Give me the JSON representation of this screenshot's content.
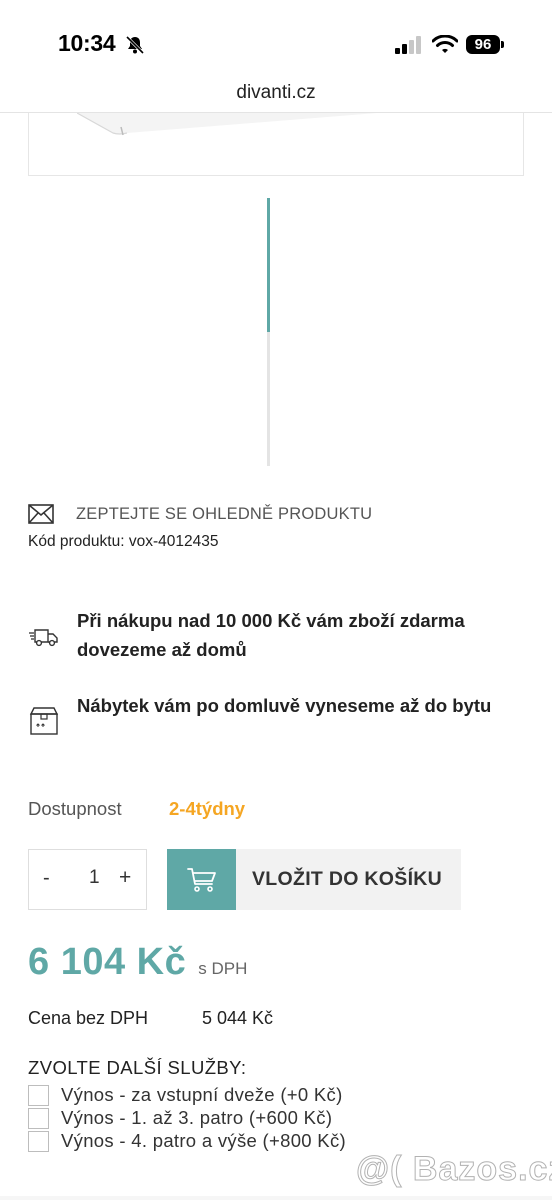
{
  "status_bar": {
    "time": "10:34",
    "battery": "96",
    "icons": [
      "bell-slash-icon",
      "signal-icon",
      "wifi-icon",
      "battery-icon"
    ]
  },
  "browser": {
    "url": "divanti.cz"
  },
  "product": {
    "ask_label": "ZEPTEJTE SE OHLEDNĚ PRODUKTU",
    "code_line": "Kód produktu: vox-4012435"
  },
  "benefits": [
    {
      "icon": "delivery-truck-icon",
      "text": "Při nákupu nad 10 000 Kč vám zboží zdarma dovezeme až domů"
    },
    {
      "icon": "box-icon",
      "text": "Nábytek vám po domluvě vyneseme až do bytu"
    }
  ],
  "availability": {
    "label": "Dostupnost",
    "value": "2-4týdny",
    "color": "#f5a623"
  },
  "quantity": {
    "minus": "-",
    "value": "1",
    "plus": "+"
  },
  "cart": {
    "button_label": "VLOŽIT DO KOŠÍKU",
    "accent": "#5fa8a6"
  },
  "price": {
    "main": "6 104 Kč",
    "vat_note": "s DPH",
    "net_label": "Cena bez DPH",
    "net_value": "5 044 Kč"
  },
  "services": {
    "title": "ZVOLTE DALŠÍ SLUŽBY:",
    "items": [
      "Výnos - za vstupní dveže (+0 Kč)",
      "Výnos - 1. až 3. patro (+600 Kč)",
      "Výnos - 4. patro a výše (+800 Kč)"
    ]
  },
  "watermark": "@( Bazos.cz"
}
